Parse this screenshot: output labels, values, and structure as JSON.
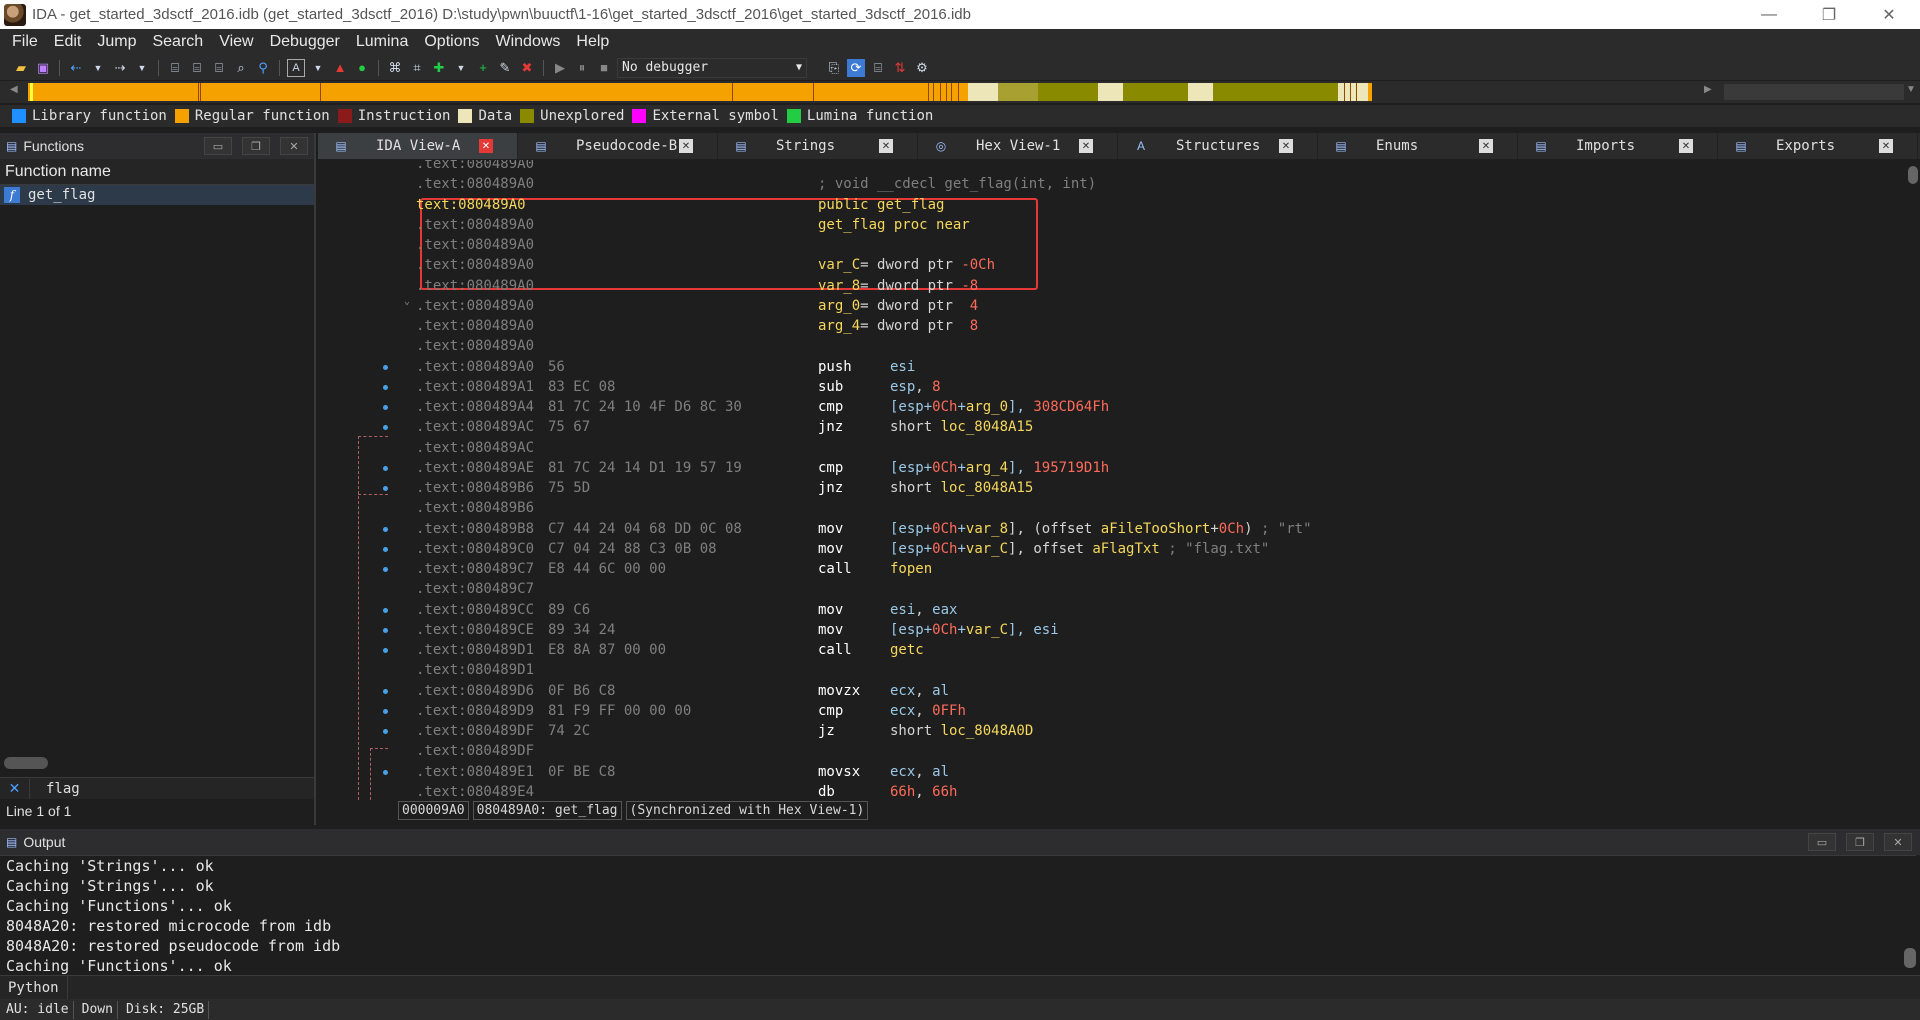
{
  "window": {
    "title": "IDA - get_started_3dsctf_2016.idb (get_started_3dsctf_2016) D:\\study\\pwn\\buuctf\\1-16\\get_started_3dsctf_2016\\get_started_3dsctf_2016.idb",
    "minimize": "—",
    "restore": "❐",
    "close": "✕"
  },
  "menu": [
    "File",
    "Edit",
    "Jump",
    "Search",
    "View",
    "Debugger",
    "Lumina",
    "Options",
    "Windows",
    "Help"
  ],
  "toolbar": {
    "debugger_select": "No debugger"
  },
  "legend": [
    {
      "label": "Library function",
      "color": "#1e90ff"
    },
    {
      "label": "Regular function",
      "color": "#f5a100"
    },
    {
      "label": "Instruction",
      "color": "#8b1a1a"
    },
    {
      "label": "Data",
      "color": "#ede6b8"
    },
    {
      "label": "Unexplored",
      "color": "#8a8a00"
    },
    {
      "label": "External symbol",
      "color": "#ff00ff"
    },
    {
      "label": "Lumina function",
      "color": "#22cc44"
    }
  ],
  "functions_panel": {
    "title": "Functions",
    "column": "Function name",
    "items": [
      "get_flag"
    ],
    "filter": "flag",
    "line_count": "Line 1 of 1"
  },
  "tabs": [
    {
      "label": "IDA View-A",
      "icon": "▤",
      "active": true
    },
    {
      "label": "Pseudocode-B",
      "icon": "▤",
      "active": false
    },
    {
      "label": "Strings",
      "icon": "▤",
      "active": false
    },
    {
      "label": "Hex View-1",
      "icon": "◎",
      "active": false
    },
    {
      "label": "Structures",
      "icon": "A",
      "active": false
    },
    {
      "label": "Enums",
      "icon": "▤",
      "active": false
    },
    {
      "label": "Imports",
      "icon": "▤",
      "active": false
    },
    {
      "label": "Exports",
      "icon": "▤",
      "active": false
    }
  ],
  "disasm": [
    {
      "addr": ".text:080489A0",
      "bytes": "",
      "parts": []
    },
    {
      "addr": ".text:080489A0",
      "bytes": "",
      "parts": [
        {
          "t": "; void __cdecl get_flag(int, int)",
          "c": "comment"
        }
      ],
      "full": true
    },
    {
      "addr": "text:080489A0",
      "bytes": "",
      "hl": true,
      "parts": [
        {
          "t": "public ",
          "c": "kw"
        },
        {
          "t": "get_flag",
          "c": "name"
        }
      ],
      "full": true
    },
    {
      "addr": ".text:080489A0",
      "bytes": "",
      "parts": [
        {
          "t": "get_flag",
          "c": "name"
        },
        {
          "t": " proc near",
          "c": "kw"
        }
      ],
      "full": true
    },
    {
      "addr": ".text:080489A0",
      "bytes": "",
      "parts": []
    },
    {
      "addr": ".text:080489A0",
      "bytes": "",
      "parts": [
        {
          "t": "var_C",
          "c": "name"
        },
        {
          "t": "= dword ptr ",
          "c": "plain"
        },
        {
          "t": "-0Ch",
          "c": "num"
        }
      ],
      "full": true
    },
    {
      "addr": ".text:080489A0",
      "bytes": "",
      "parts": [
        {
          "t": "var_8",
          "c": "name"
        },
        {
          "t": "= dword ptr ",
          "c": "plain"
        },
        {
          "t": "-8",
          "c": "num"
        }
      ],
      "full": true
    },
    {
      "addr": ".text:080489A0",
      "bytes": "",
      "parts": [
        {
          "t": "arg_0",
          "c": "name"
        },
        {
          "t": "= dword ptr  ",
          "c": "plain"
        },
        {
          "t": "4",
          "c": "num"
        }
      ],
      "full": true
    },
    {
      "addr": ".text:080489A0",
      "bytes": "",
      "parts": [
        {
          "t": "arg_4",
          "c": "name"
        },
        {
          "t": "= dword ptr  ",
          "c": "plain"
        },
        {
          "t": "8",
          "c": "num"
        }
      ],
      "full": true
    },
    {
      "addr": ".text:080489A0",
      "bytes": "",
      "parts": []
    },
    {
      "addr": ".text:080489A0",
      "bytes": "56",
      "mnem": "push",
      "parts": [
        {
          "t": "esi",
          "c": "reg"
        }
      ]
    },
    {
      "addr": ".text:080489A1",
      "bytes": "83 EC 08",
      "mnem": "sub",
      "parts": [
        {
          "t": "esp",
          "c": "reg"
        },
        {
          "t": ", ",
          "c": "plain"
        },
        {
          "t": "8",
          "c": "num"
        }
      ]
    },
    {
      "addr": ".text:080489A4",
      "bytes": "81 7C 24 10 4F D6 8C 30",
      "mnem": "cmp",
      "parts": [
        {
          "t": "[esp+",
          "c": "reg"
        },
        {
          "t": "0Ch",
          "c": "num"
        },
        {
          "t": "+",
          "c": "reg"
        },
        {
          "t": "arg_0",
          "c": "name"
        },
        {
          "t": "], ",
          "c": "reg"
        },
        {
          "t": "308CD64Fh",
          "c": "num"
        }
      ]
    },
    {
      "addr": ".text:080489AC",
      "bytes": "75 67",
      "mnem": "jnz",
      "parts": [
        {
          "t": "short ",
          "c": "plain"
        },
        {
          "t": "loc_8048A15",
          "c": "name"
        }
      ]
    },
    {
      "addr": ".text:080489AC",
      "bytes": "",
      "parts": []
    },
    {
      "addr": ".text:080489AE",
      "bytes": "81 7C 24 14 D1 19 57 19",
      "mnem": "cmp",
      "parts": [
        {
          "t": "[esp+",
          "c": "reg"
        },
        {
          "t": "0Ch",
          "c": "num"
        },
        {
          "t": "+",
          "c": "reg"
        },
        {
          "t": "arg_4",
          "c": "name"
        },
        {
          "t": "], ",
          "c": "reg"
        },
        {
          "t": "195719D1h",
          "c": "num"
        }
      ]
    },
    {
      "addr": ".text:080489B6",
      "bytes": "75 5D",
      "mnem": "jnz",
      "parts": [
        {
          "t": "short ",
          "c": "plain"
        },
        {
          "t": "loc_8048A15",
          "c": "name"
        }
      ]
    },
    {
      "addr": ".text:080489B6",
      "bytes": "",
      "parts": []
    },
    {
      "addr": ".text:080489B8",
      "bytes": "C7 44 24 04 68 DD 0C 08",
      "mnem": "mov",
      "parts": [
        {
          "t": "[esp+",
          "c": "reg"
        },
        {
          "t": "0Ch",
          "c": "num"
        },
        {
          "t": "+",
          "c": "reg"
        },
        {
          "t": "var_8",
          "c": "name"
        },
        {
          "t": "], (offset ",
          "c": "plain"
        },
        {
          "t": "aFileTooShort",
          "c": "name"
        },
        {
          "t": "+",
          "c": "plain"
        },
        {
          "t": "0Ch",
          "c": "num"
        },
        {
          "t": ") ",
          "c": "plain"
        },
        {
          "t": "; \"rt\"",
          "c": "comment"
        }
      ]
    },
    {
      "addr": ".text:080489C0",
      "bytes": "C7 04 24 88 C3 0B 08",
      "mnem": "mov",
      "parts": [
        {
          "t": "[esp+",
          "c": "reg"
        },
        {
          "t": "0Ch",
          "c": "num"
        },
        {
          "t": "+",
          "c": "reg"
        },
        {
          "t": "var_C",
          "c": "name"
        },
        {
          "t": "], offset ",
          "c": "plain"
        },
        {
          "t": "aFlagTxt",
          "c": "name"
        },
        {
          "t": " ",
          "c": "plain"
        },
        {
          "t": "; \"flag.txt\"",
          "c": "comment"
        }
      ]
    },
    {
      "addr": ".text:080489C7",
      "bytes": "E8 44 6C 00 00",
      "mnem": "call",
      "parts": [
        {
          "t": "fopen",
          "c": "name"
        }
      ]
    },
    {
      "addr": ".text:080489C7",
      "bytes": "",
      "parts": []
    },
    {
      "addr": ".text:080489CC",
      "bytes": "89 C6",
      "mnem": "mov",
      "parts": [
        {
          "t": "esi",
          "c": "reg"
        },
        {
          "t": ", ",
          "c": "plain"
        },
        {
          "t": "eax",
          "c": "reg"
        }
      ]
    },
    {
      "addr": ".text:080489CE",
      "bytes": "89 34 24",
      "mnem": "mov",
      "parts": [
        {
          "t": "[esp+",
          "c": "reg"
        },
        {
          "t": "0Ch",
          "c": "num"
        },
        {
          "t": "+",
          "c": "reg"
        },
        {
          "t": "var_C",
          "c": "name"
        },
        {
          "t": "], ",
          "c": "reg"
        },
        {
          "t": "esi",
          "c": "reg"
        }
      ]
    },
    {
      "addr": ".text:080489D1",
      "bytes": "E8 8A 87 00 00",
      "mnem": "call",
      "parts": [
        {
          "t": "getc",
          "c": "name"
        }
      ]
    },
    {
      "addr": ".text:080489D1",
      "bytes": "",
      "parts": []
    },
    {
      "addr": ".text:080489D6",
      "bytes": "0F B6 C8",
      "mnem": "movzx",
      "parts": [
        {
          "t": "ecx",
          "c": "reg"
        },
        {
          "t": ", ",
          "c": "plain"
        },
        {
          "t": "al",
          "c": "reg"
        }
      ]
    },
    {
      "addr": ".text:080489D9",
      "bytes": "81 F9 FF 00 00 00",
      "mnem": "cmp",
      "parts": [
        {
          "t": "ecx",
          "c": "reg"
        },
        {
          "t": ", ",
          "c": "plain"
        },
        {
          "t": "0FFh",
          "c": "num"
        }
      ]
    },
    {
      "addr": ".text:080489DF",
      "bytes": "74 2C",
      "mnem": "jz",
      "parts": [
        {
          "t": "short ",
          "c": "plain"
        },
        {
          "t": "loc_8048A0D",
          "c": "name"
        }
      ]
    },
    {
      "addr": ".text:080489DF",
      "bytes": "",
      "parts": []
    },
    {
      "addr": ".text:080489E1",
      "bytes": "0F BE C8",
      "mnem": "movsx",
      "parts": [
        {
          "t": "ecx",
          "c": "reg"
        },
        {
          "t": ", ",
          "c": "plain"
        },
        {
          "t": "al",
          "c": "reg"
        }
      ]
    },
    {
      "addr": ".text:080489E4",
      "bytes": "",
      "mnem": "db",
      "parts": [
        {
          "t": "66h",
          "c": "num"
        },
        {
          "t": ", ",
          "c": "plain"
        },
        {
          "t": "66h",
          "c": "num"
        }
      ]
    }
  ],
  "view_status": [
    "000009A0",
    "080489A0: get_flag",
    "(Synchronized with Hex View-1)"
  ],
  "output": {
    "title": "Output",
    "lines": [
      "Caching 'Strings'... ok",
      "Caching 'Strings'... ok",
      "Caching 'Functions'... ok",
      "8048A20: restored microcode from idb",
      "8048A20: restored pseudocode from idb",
      "Caching 'Functions'... ok"
    ],
    "python_label": "Python"
  },
  "statusbar": [
    "AU:  idle",
    "Down",
    "Disk: 25GB"
  ]
}
